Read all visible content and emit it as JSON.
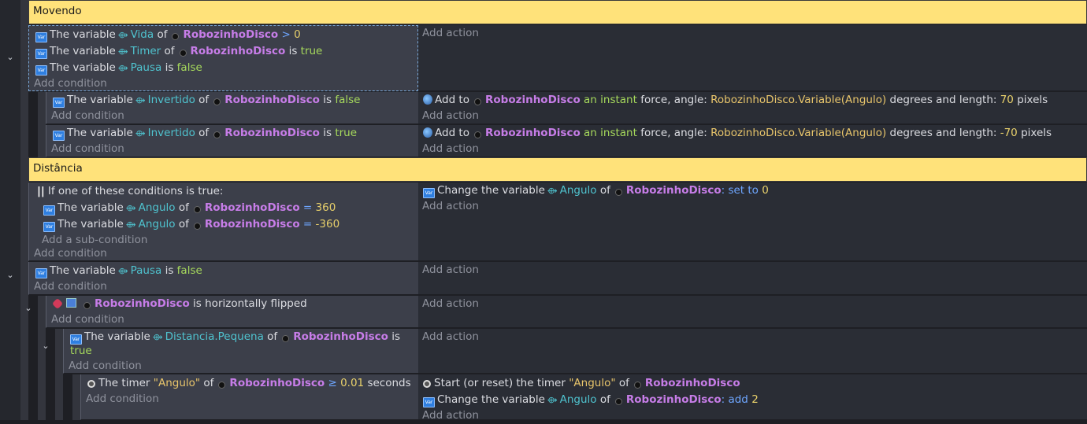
{
  "comments": {
    "movendo": "Movendo",
    "distancia": "Distância"
  },
  "icons": {
    "variable": "variable-icon",
    "global": "scene-variable-icon",
    "object": "object-icon",
    "force": "force-icon",
    "timer": "timer-icon",
    "chevron": "chevron-down-icon"
  },
  "colors": {
    "comment_bg": "#ffe27a",
    "condition_bg": "#3c3f4a",
    "action_bg": "#2a2d35",
    "object_name": "#c77de8",
    "variable_name": "#4fc3cf"
  },
  "labels": {
    "add_action": "Add action",
    "add_condition": "Add condition",
    "add_subcondition": "Add a sub-condition",
    "the_variable": "The variable",
    "of": "of",
    "is": "is"
  },
  "events": {
    "e1": {
      "c1": {
        "var": "Vida",
        "obj": "RobozinhoDisco",
        "op": ">",
        "val": "0"
      },
      "c2": {
        "var": "Timer",
        "obj": "RobozinhoDisco",
        "op": "is",
        "val": "true"
      },
      "c3": {
        "var": "Pausa",
        "op": "is",
        "val": "false"
      }
    },
    "e1a": {
      "c": {
        "var": "Invertido",
        "obj": "RobozinhoDisco",
        "op": "is",
        "val": "false"
      },
      "a": {
        "pre": "Add to",
        "obj": "RobozinhoDisco",
        "force": "an instant",
        "mid": "force, angle:",
        "angle": "RobozinhoDisco.Variable(Angulo)",
        "mid2": "degrees and length:",
        "len": "70",
        "unit": "pixels"
      }
    },
    "e1b": {
      "c": {
        "var": "Invertido",
        "obj": "RobozinhoDisco",
        "op": "is",
        "val": "true"
      },
      "a": {
        "pre": "Add to",
        "obj": "RobozinhoDisco",
        "force": "an instant",
        "mid": "force, angle:",
        "angle": "RobozinhoDisco.Variable(Angulo)",
        "mid2": "degrees and length:",
        "len": "-70",
        "unit": "pixels"
      }
    },
    "e2": {
      "or": "If one of these conditions is true:",
      "c1": {
        "var": "Angulo",
        "obj": "RobozinhoDisco",
        "op": "=",
        "val": "360"
      },
      "c2": {
        "var": "Angulo",
        "obj": "RobozinhoDisco",
        "op": "=",
        "val": "-360"
      },
      "a": {
        "pre": "Change the variable",
        "var": "Angulo",
        "obj": "RobozinhoDisco",
        "op": ": set to",
        "val": "0"
      }
    },
    "e3": {
      "c": {
        "var": "Pausa",
        "op": "is",
        "val": "false"
      }
    },
    "e4": {
      "c": {
        "obj": "RobozinhoDisco",
        "text": "is horizontally flipped"
      }
    },
    "e5": {
      "c": {
        "var": "Distancia.Pequena",
        "obj": "RobozinhoDisco",
        "op": "is",
        "val": "true"
      }
    },
    "e6": {
      "c": {
        "pre": "The timer",
        "timer": "\"Angulo\"",
        "obj": "RobozinhoDisco",
        "op": "≥",
        "val": "0.01",
        "unit": "seconds"
      },
      "a1": {
        "pre": "Start (or reset) the timer",
        "timer": "\"Angulo\"",
        "obj": "RobozinhoDisco"
      },
      "a2": {
        "pre": "Change the variable",
        "var": "Angulo",
        "obj": "RobozinhoDisco",
        "op": ": add",
        "val": "2"
      }
    }
  }
}
